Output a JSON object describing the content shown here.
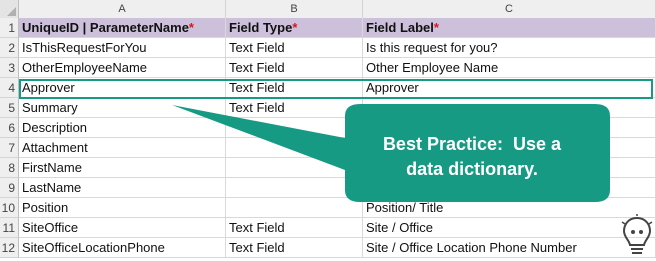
{
  "columns": [
    "A",
    "B",
    "C"
  ],
  "rows": [
    {
      "num": "1",
      "cells": [
        "UniqueID | ParameterName",
        "Field Type",
        "Field Label"
      ],
      "required": [
        true,
        true,
        true
      ]
    },
    {
      "num": "2",
      "cells": [
        "IsThisRequestForYou",
        "Text Field",
        "Is this request for you?"
      ]
    },
    {
      "num": "3",
      "cells": [
        "OtherEmployeeName",
        "Text Field",
        "Other Employee Name"
      ]
    },
    {
      "num": "4",
      "cells": [
        "Approver",
        "Text Field",
        "Approver"
      ]
    },
    {
      "num": "5",
      "cells": [
        "Summary",
        "Text Field",
        ""
      ]
    },
    {
      "num": "6",
      "cells": [
        "Description",
        "",
        ""
      ]
    },
    {
      "num": "7",
      "cells": [
        "Attachment",
        "",
        ""
      ]
    },
    {
      "num": "8",
      "cells": [
        "FirstName",
        "",
        ""
      ]
    },
    {
      "num": "9",
      "cells": [
        "LastName",
        "",
        ""
      ]
    },
    {
      "num": "10",
      "cells": [
        "Position",
        "",
        "Position/ Title"
      ]
    },
    {
      "num": "11",
      "cells": [
        "SiteOffice",
        "Text Field",
        "Site / Office"
      ]
    },
    {
      "num": "12",
      "cells": [
        "SiteOfficeLocationPhone",
        "Text Field",
        "Site / Office Location Phone Number"
      ]
    }
  ],
  "required_marker": "*",
  "callout": {
    "line1_strong": "Best Practice:",
    "line1_rest": "Use a",
    "line2": "data dictionary",
    "line2_end": "."
  },
  "colors": {
    "header_fill": "#ccc0da",
    "callout_fill": "#179a84",
    "required": "#e0141e",
    "highlight_border": "#179a84"
  },
  "icons": [
    "select-all-icon",
    "lightbulb-icon"
  ]
}
